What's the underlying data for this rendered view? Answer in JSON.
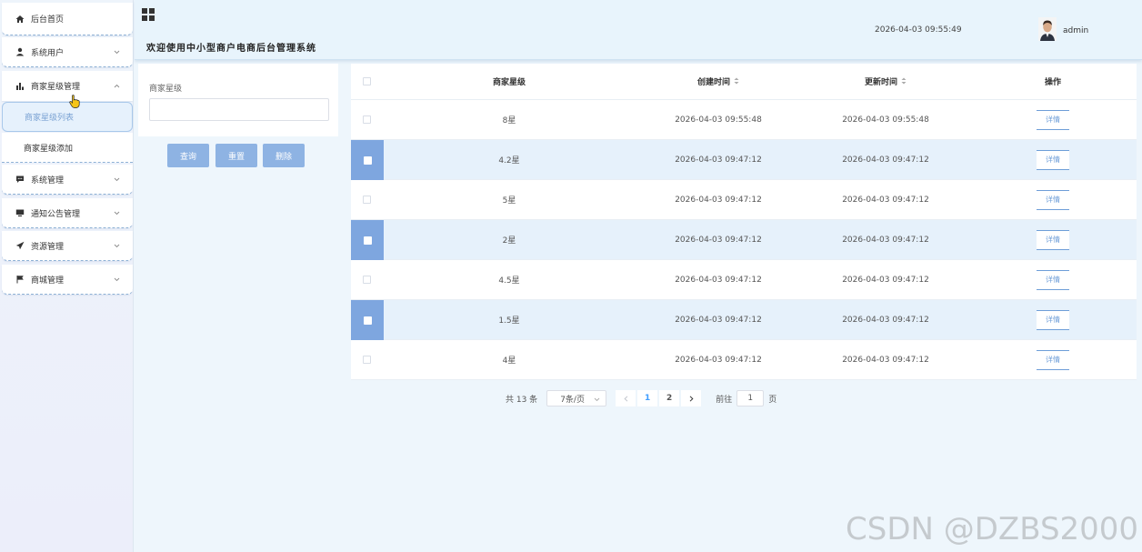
{
  "sidebar": {
    "home": "后台首页",
    "items": [
      {
        "label": "系统用户",
        "icon": "user-icon"
      },
      {
        "label": "商家星级管理",
        "icon": "bar-chart-icon"
      },
      {
        "label": "系统管理",
        "icon": "chat-icon"
      },
      {
        "label": "通知公告管理",
        "icon": "monitor-icon"
      },
      {
        "label": "资源管理",
        "icon": "send-icon"
      },
      {
        "label": "商城管理",
        "icon": "flag-icon"
      }
    ],
    "sub_items": [
      "商家星级列表",
      "商家星级添加"
    ]
  },
  "header": {
    "title": "欢迎使用中小型商户电商后台管理系统",
    "datetime": "2026-04-03 09:55:49",
    "username": "admin"
  },
  "search": {
    "label": "商家星级",
    "value": "",
    "buttons": {
      "query": "查询",
      "reset": "重置",
      "delete": "删除"
    }
  },
  "table": {
    "headers": {
      "star": "商家星级",
      "created": "创建时间",
      "updated": "更新时间",
      "action": "操作"
    },
    "detail_label": "详情",
    "rows": [
      {
        "star": "8星",
        "created": "2026-04-03 09:55:48",
        "updated": "2026-04-03 09:55:48",
        "selected": false
      },
      {
        "star": "4.2星",
        "created": "2026-04-03 09:47:12",
        "updated": "2026-04-03 09:47:12",
        "selected": true
      },
      {
        "star": "5星",
        "created": "2026-04-03 09:47:12",
        "updated": "2026-04-03 09:47:12",
        "selected": false
      },
      {
        "star": "2星",
        "created": "2026-04-03 09:47:12",
        "updated": "2026-04-03 09:47:12",
        "selected": true
      },
      {
        "star": "4.5星",
        "created": "2026-04-03 09:47:12",
        "updated": "2026-04-03 09:47:12",
        "selected": false
      },
      {
        "star": "1.5星",
        "created": "2026-04-03 09:47:12",
        "updated": "2026-04-03 09:47:12",
        "selected": true
      },
      {
        "star": "4星",
        "created": "2026-04-03 09:47:12",
        "updated": "2026-04-03 09:47:12",
        "selected": false
      }
    ]
  },
  "pagination": {
    "total": "共 13 条",
    "page_size": "7条/页",
    "pages": [
      "1",
      "2"
    ],
    "current": "1",
    "goto_prefix": "前往",
    "goto_value": "1",
    "goto_suffix": "页"
  },
  "watermark": "CSDN @DZBS2000",
  "colors": {
    "accent": "#409eff",
    "button": "#8eb3e3",
    "selected_checkbox": "#7ea6df",
    "row_selected": "#e6f1fb",
    "header_bg": "#e8f4fc"
  }
}
